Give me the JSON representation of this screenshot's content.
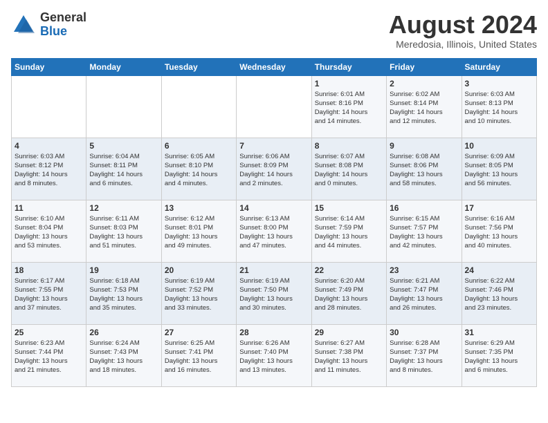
{
  "logo": {
    "general": "General",
    "blue": "Blue"
  },
  "title": "August 2024",
  "location": "Meredosia, Illinois, United States",
  "days_of_week": [
    "Sunday",
    "Monday",
    "Tuesday",
    "Wednesday",
    "Thursday",
    "Friday",
    "Saturday"
  ],
  "weeks": [
    [
      {
        "day": "",
        "detail": ""
      },
      {
        "day": "",
        "detail": ""
      },
      {
        "day": "",
        "detail": ""
      },
      {
        "day": "",
        "detail": ""
      },
      {
        "day": "1",
        "detail": "Sunrise: 6:01 AM\nSunset: 8:16 PM\nDaylight: 14 hours\nand 14 minutes."
      },
      {
        "day": "2",
        "detail": "Sunrise: 6:02 AM\nSunset: 8:14 PM\nDaylight: 14 hours\nand 12 minutes."
      },
      {
        "day": "3",
        "detail": "Sunrise: 6:03 AM\nSunset: 8:13 PM\nDaylight: 14 hours\nand 10 minutes."
      }
    ],
    [
      {
        "day": "4",
        "detail": "Sunrise: 6:03 AM\nSunset: 8:12 PM\nDaylight: 14 hours\nand 8 minutes."
      },
      {
        "day": "5",
        "detail": "Sunrise: 6:04 AM\nSunset: 8:11 PM\nDaylight: 14 hours\nand 6 minutes."
      },
      {
        "day": "6",
        "detail": "Sunrise: 6:05 AM\nSunset: 8:10 PM\nDaylight: 14 hours\nand 4 minutes."
      },
      {
        "day": "7",
        "detail": "Sunrise: 6:06 AM\nSunset: 8:09 PM\nDaylight: 14 hours\nand 2 minutes."
      },
      {
        "day": "8",
        "detail": "Sunrise: 6:07 AM\nSunset: 8:08 PM\nDaylight: 14 hours\nand 0 minutes."
      },
      {
        "day": "9",
        "detail": "Sunrise: 6:08 AM\nSunset: 8:06 PM\nDaylight: 13 hours\nand 58 minutes."
      },
      {
        "day": "10",
        "detail": "Sunrise: 6:09 AM\nSunset: 8:05 PM\nDaylight: 13 hours\nand 56 minutes."
      }
    ],
    [
      {
        "day": "11",
        "detail": "Sunrise: 6:10 AM\nSunset: 8:04 PM\nDaylight: 13 hours\nand 53 minutes."
      },
      {
        "day": "12",
        "detail": "Sunrise: 6:11 AM\nSunset: 8:03 PM\nDaylight: 13 hours\nand 51 minutes."
      },
      {
        "day": "13",
        "detail": "Sunrise: 6:12 AM\nSunset: 8:01 PM\nDaylight: 13 hours\nand 49 minutes."
      },
      {
        "day": "14",
        "detail": "Sunrise: 6:13 AM\nSunset: 8:00 PM\nDaylight: 13 hours\nand 47 minutes."
      },
      {
        "day": "15",
        "detail": "Sunrise: 6:14 AM\nSunset: 7:59 PM\nDaylight: 13 hours\nand 44 minutes."
      },
      {
        "day": "16",
        "detail": "Sunrise: 6:15 AM\nSunset: 7:57 PM\nDaylight: 13 hours\nand 42 minutes."
      },
      {
        "day": "17",
        "detail": "Sunrise: 6:16 AM\nSunset: 7:56 PM\nDaylight: 13 hours\nand 40 minutes."
      }
    ],
    [
      {
        "day": "18",
        "detail": "Sunrise: 6:17 AM\nSunset: 7:55 PM\nDaylight: 13 hours\nand 37 minutes."
      },
      {
        "day": "19",
        "detail": "Sunrise: 6:18 AM\nSunset: 7:53 PM\nDaylight: 13 hours\nand 35 minutes."
      },
      {
        "day": "20",
        "detail": "Sunrise: 6:19 AM\nSunset: 7:52 PM\nDaylight: 13 hours\nand 33 minutes."
      },
      {
        "day": "21",
        "detail": "Sunrise: 6:19 AM\nSunset: 7:50 PM\nDaylight: 13 hours\nand 30 minutes."
      },
      {
        "day": "22",
        "detail": "Sunrise: 6:20 AM\nSunset: 7:49 PM\nDaylight: 13 hours\nand 28 minutes."
      },
      {
        "day": "23",
        "detail": "Sunrise: 6:21 AM\nSunset: 7:47 PM\nDaylight: 13 hours\nand 26 minutes."
      },
      {
        "day": "24",
        "detail": "Sunrise: 6:22 AM\nSunset: 7:46 PM\nDaylight: 13 hours\nand 23 minutes."
      }
    ],
    [
      {
        "day": "25",
        "detail": "Sunrise: 6:23 AM\nSunset: 7:44 PM\nDaylight: 13 hours\nand 21 minutes."
      },
      {
        "day": "26",
        "detail": "Sunrise: 6:24 AM\nSunset: 7:43 PM\nDaylight: 13 hours\nand 18 minutes."
      },
      {
        "day": "27",
        "detail": "Sunrise: 6:25 AM\nSunset: 7:41 PM\nDaylight: 13 hours\nand 16 minutes."
      },
      {
        "day": "28",
        "detail": "Sunrise: 6:26 AM\nSunset: 7:40 PM\nDaylight: 13 hours\nand 13 minutes."
      },
      {
        "day": "29",
        "detail": "Sunrise: 6:27 AM\nSunset: 7:38 PM\nDaylight: 13 hours\nand 11 minutes."
      },
      {
        "day": "30",
        "detail": "Sunrise: 6:28 AM\nSunset: 7:37 PM\nDaylight: 13 hours\nand 8 minutes."
      },
      {
        "day": "31",
        "detail": "Sunrise: 6:29 AM\nSunset: 7:35 PM\nDaylight: 13 hours\nand 6 minutes."
      }
    ]
  ]
}
